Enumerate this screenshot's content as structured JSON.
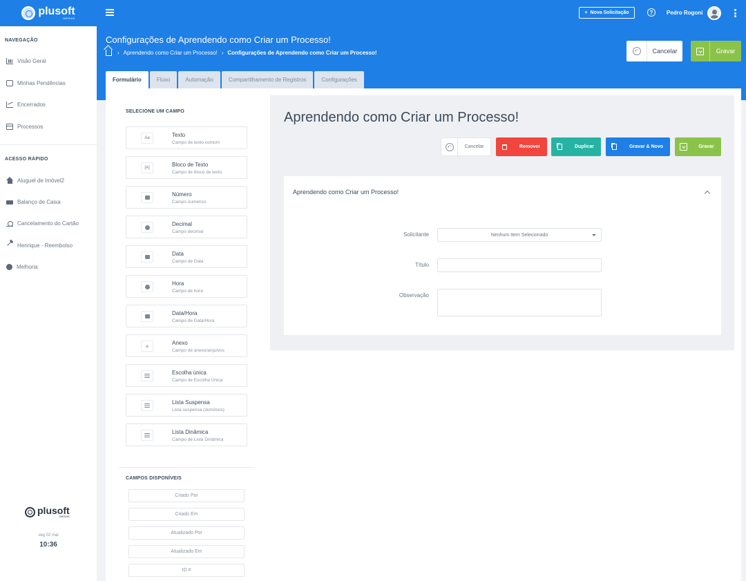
{
  "brand": {
    "name": "plusoft",
    "sub": "INFRAS"
  },
  "topbar": {
    "new_request": "Nova Solicitação",
    "help": "?",
    "user": "Pedro Rogoni"
  },
  "header": {
    "title": "Configurações de Aprendendo como Criar um Processo!",
    "breadcrumb": [
      "Aprendendo como Criar um Processo!",
      "Configurações de Aprendendo como Criar um Processo!"
    ],
    "cancel": "Cancelar",
    "save": "Gravar"
  },
  "tabs": [
    "Formulário",
    "Fluxo",
    "Automação",
    "Compartilhamento de Registros",
    "Configurações"
  ],
  "sidebar": {
    "nav_title": "NAVEGAÇÃO",
    "nav": [
      "Visão Geral",
      "Minhas Pendências",
      "Encerrados",
      "Processos"
    ],
    "quick_title": "ACESSO RÁPIDO",
    "quick": [
      "Aluguel de Imóvel2",
      "Balanço de Caixa",
      "Cancelamento do Cartão",
      "Henrique - Reembolso",
      "Melhoria"
    ],
    "date": "seg 02 mai",
    "time": "10:36"
  },
  "fields_panel": {
    "title": "SELECIONE UM CAMPO",
    "fields": [
      {
        "name": "Texto",
        "desc": "Campo de texto comum",
        "icon": "Aa"
      },
      {
        "name": "Bloco de Texto",
        "desc": "Campo de bloco de texto",
        "icon": "[A]"
      },
      {
        "name": "Número",
        "desc": "Campo numérico",
        "icon": "number-icon"
      },
      {
        "name": "Decimal",
        "desc": "Campo decimal",
        "icon": "decimal-icon"
      },
      {
        "name": "Data",
        "desc": "Campo de Data",
        "icon": "date-icon"
      },
      {
        "name": "Hora",
        "desc": "Campo de hora",
        "icon": "clock-icon"
      },
      {
        "name": "Data/Hora",
        "desc": "Campo de Data/Hora",
        "icon": "datetime-icon"
      },
      {
        "name": "Anexo",
        "desc": "Campo de anexo/arquivos",
        "icon": "paperclip-icon"
      },
      {
        "name": "Escolha única",
        "desc": "Campo de Escolha Única",
        "icon": "list-icon"
      },
      {
        "name": "Lista Suspensa",
        "desc": "Lista suspensa (domínios)",
        "icon": "list-icon"
      },
      {
        "name": "Lista Dinâmica",
        "desc": "Campo de Lista Dinâmica",
        "icon": "list-icon"
      }
    ],
    "available_title": "CAMPOS DISPONÍVEIS",
    "available": [
      "Criado Por",
      "Criado Em",
      "Atualizado Por",
      "Atualizado Em",
      "ID #"
    ]
  },
  "preview": {
    "title": "Aprendendo como Criar um Processo!",
    "buttons": {
      "cancel": "Cancelar",
      "remove": "Remover",
      "duplicate": "Duplicar",
      "save_new": "Gravar & Novo",
      "save": "Gravar"
    },
    "colors": {
      "remove": "#f1453d",
      "duplicate": "#26b3a3",
      "save_new": "#1e7fe6",
      "save": "#8bc34a"
    },
    "card_title": "Aprendendo como Criar um Processo!",
    "form": {
      "requester_label": "Solicitante",
      "requester_value": "Nenhum Item Selecionado",
      "title_label": "Título",
      "notes_label": "Observação"
    }
  }
}
